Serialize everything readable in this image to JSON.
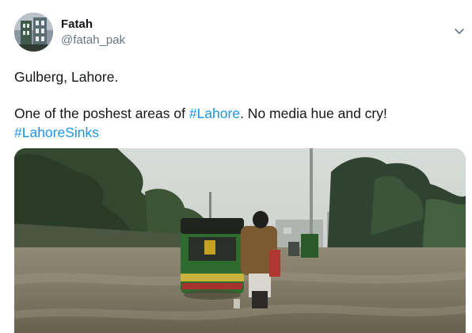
{
  "author": {
    "name": "Fatah",
    "handle": "@fatah_pak"
  },
  "tweet": {
    "line1": "Gulberg, Lahore.",
    "line2_before": "One of the poshest areas of ",
    "line2_link": "#Lahore",
    "line2_after": ". No media hue and cry!",
    "line3_link": "#LahoreSinks"
  },
  "icons": {
    "menu": "chevron-down-icon"
  },
  "colors": {
    "link": "#1b95e0",
    "text": "#14171a",
    "secondary": "#657786"
  }
}
